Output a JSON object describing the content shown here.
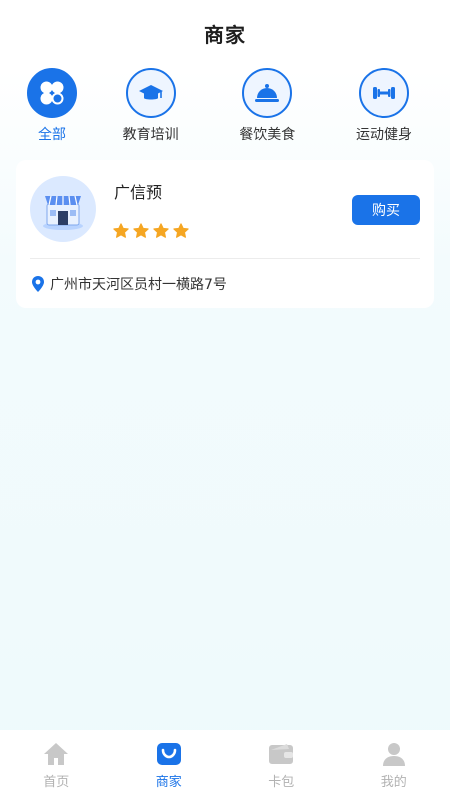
{
  "header": {
    "title": "商家"
  },
  "categories": [
    {
      "label": "全部",
      "icon": "clover-icon",
      "active": true
    },
    {
      "label": "教育培训",
      "icon": "graduation-cap-icon",
      "active": false
    },
    {
      "label": "餐饮美食",
      "icon": "food-cloche-icon",
      "active": false
    },
    {
      "label": "运动健身",
      "icon": "dumbbell-icon",
      "active": false
    }
  ],
  "merchant": {
    "name": "广信预",
    "rating": 4,
    "buy_label": "购买",
    "address": "广州市天河区员村一横路7号",
    "logo_icon": "storefront-icon"
  },
  "tabbar": {
    "items": [
      {
        "label": "首页",
        "icon": "home-icon",
        "active": false
      },
      {
        "label": "商家",
        "icon": "shopping-bag-icon",
        "active": true
      },
      {
        "label": "卡包",
        "icon": "card-wallet-icon",
        "active": false
      },
      {
        "label": "我的",
        "icon": "user-icon",
        "active": false
      }
    ]
  },
  "colors": {
    "accent": "#1a73e8",
    "star": "#f5a623",
    "inactive": "#b2b2b2"
  }
}
